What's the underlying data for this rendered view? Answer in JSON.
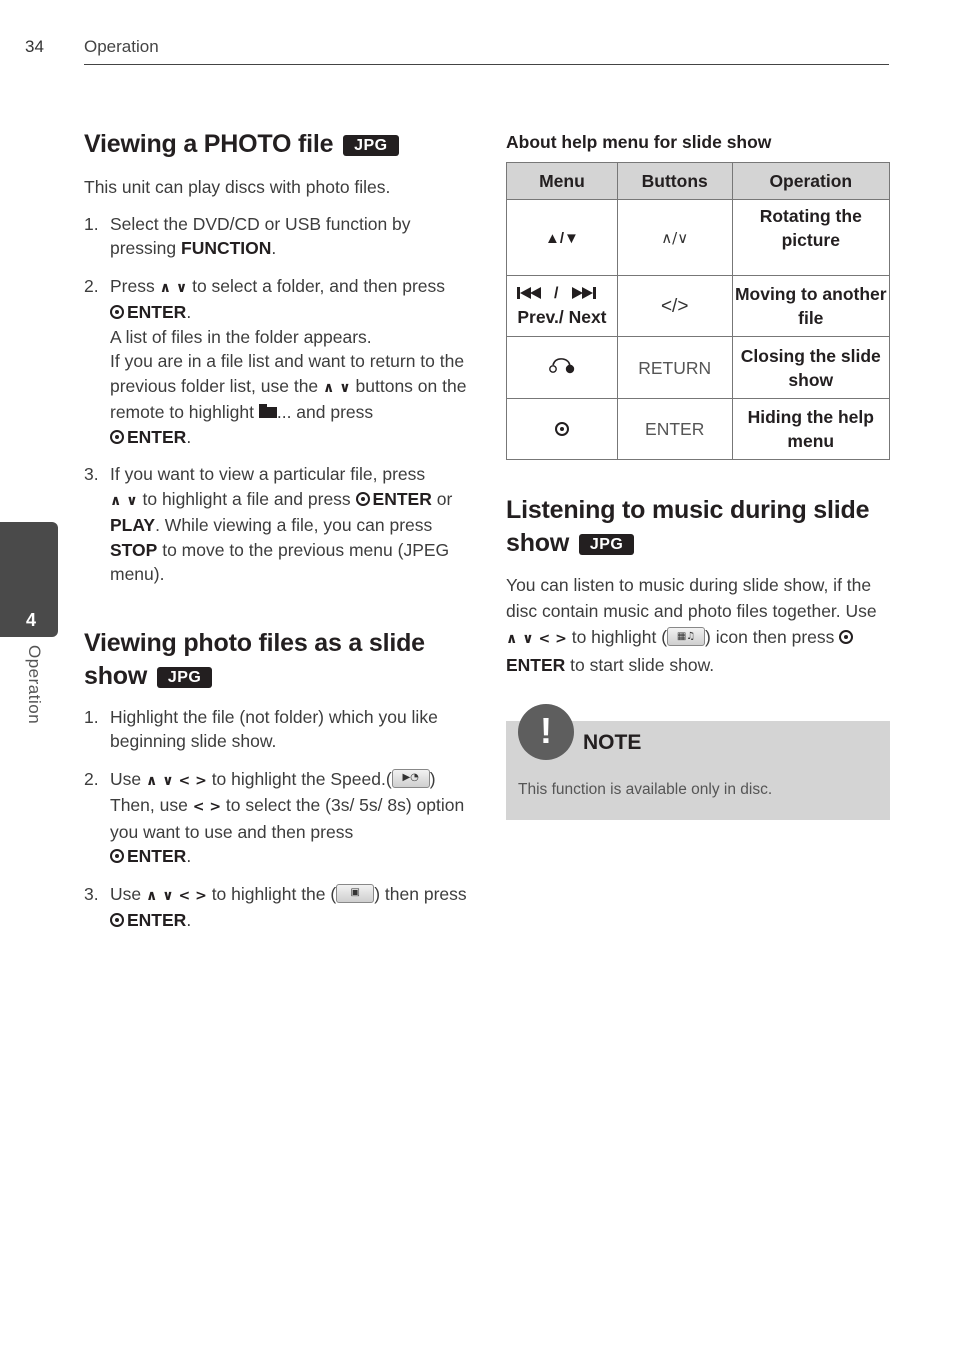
{
  "header": {
    "page_number": "34",
    "section": "Operation"
  },
  "side_tab": {
    "chapter": "4",
    "label": "Operation"
  },
  "badge_label": "JPG",
  "symbols": {
    "up": "∧",
    "down": "∨",
    "left": "<",
    "right": ">"
  },
  "section_photo": {
    "title": "Viewing a PHOTO file",
    "intro": "This unit can play discs with photo files.",
    "steps": [
      {
        "num": "1.",
        "t1": "Select the DVD/CD or USB function by pressing ",
        "b1": "FUNCTION",
        "t2": "."
      },
      {
        "num": "2.",
        "t1": "Press ",
        "t2": " to select a folder, and then press ",
        "b1": "ENTER",
        "t3": ".",
        "t4": "A list of files in the folder appears.",
        "t5": "If you are in a file list and want to return to the previous folder list, use the ",
        "t6": " buttons on the remote to highlight ",
        "t7": "... and press ",
        "b2": "ENTER",
        "t8": "."
      },
      {
        "num": "3.",
        "t1": "If you want to view a particular file, press ",
        "t2": " to highlight a file and press ",
        "b1": "ENTER",
        "t3": " or ",
        "b2": "PLAY",
        "t4": ". While viewing a file, you can press ",
        "b3": "STOP",
        "t5": " to move to the previous menu (JPEG menu)."
      }
    ]
  },
  "section_slideshow": {
    "title_line1": "Viewing photo files as a slide",
    "title_line2": "show",
    "steps": [
      {
        "num": "1.",
        "t1": "Highlight the file (not folder) which you like beginning slide show."
      },
      {
        "num": "2.",
        "t1": "Use ",
        "t2": " to highlight the Speed.(",
        "t3": ") Then, use ",
        "t4": " to select the (3s/ 5s/ 8s) option you want to use and then press ",
        "b1": "ENTER",
        "t5": "."
      },
      {
        "num": "3.",
        "t1": "Use ",
        "t2": " to highlight the (",
        "t3": ") then press ",
        "b1": "ENTER",
        "t4": "."
      }
    ]
  },
  "help_table": {
    "heading": "About help menu for slide show",
    "columns": [
      "Menu",
      "Buttons",
      "Operation"
    ],
    "rows": [
      {
        "menu": "▲/▼",
        "menu_sub": "",
        "buttons": "∧/∨",
        "operation": "Rotating the picture",
        "menu_icon": "up-down-triangle-icon"
      },
      {
        "menu": "⏮ / ⏭",
        "menu_sub": "Prev./ Next",
        "buttons": "</>",
        "operation": "Moving to another file",
        "menu_icon": "prev-next-icon"
      },
      {
        "menu": "",
        "menu_sub": "",
        "buttons": "RETURN",
        "operation": "Closing the slide show",
        "menu_icon": "return-icon"
      },
      {
        "menu": "",
        "menu_sub": "",
        "buttons": "ENTER",
        "operation": "Hiding the help menu",
        "menu_icon": "enter-icon"
      }
    ]
  },
  "section_music": {
    "title_line1": "Listening to music during slide",
    "title_line2": "show",
    "t1": "You can listen to music during slide show, if the disc contain music and photo files together. Use ",
    "t2": " to highlight (",
    "t3": ") icon then press ",
    "b1": "ENTER",
    "t4": " to start slide show."
  },
  "note": {
    "icon": "!",
    "title": "NOTE",
    "text": "This function is available only in disc."
  }
}
